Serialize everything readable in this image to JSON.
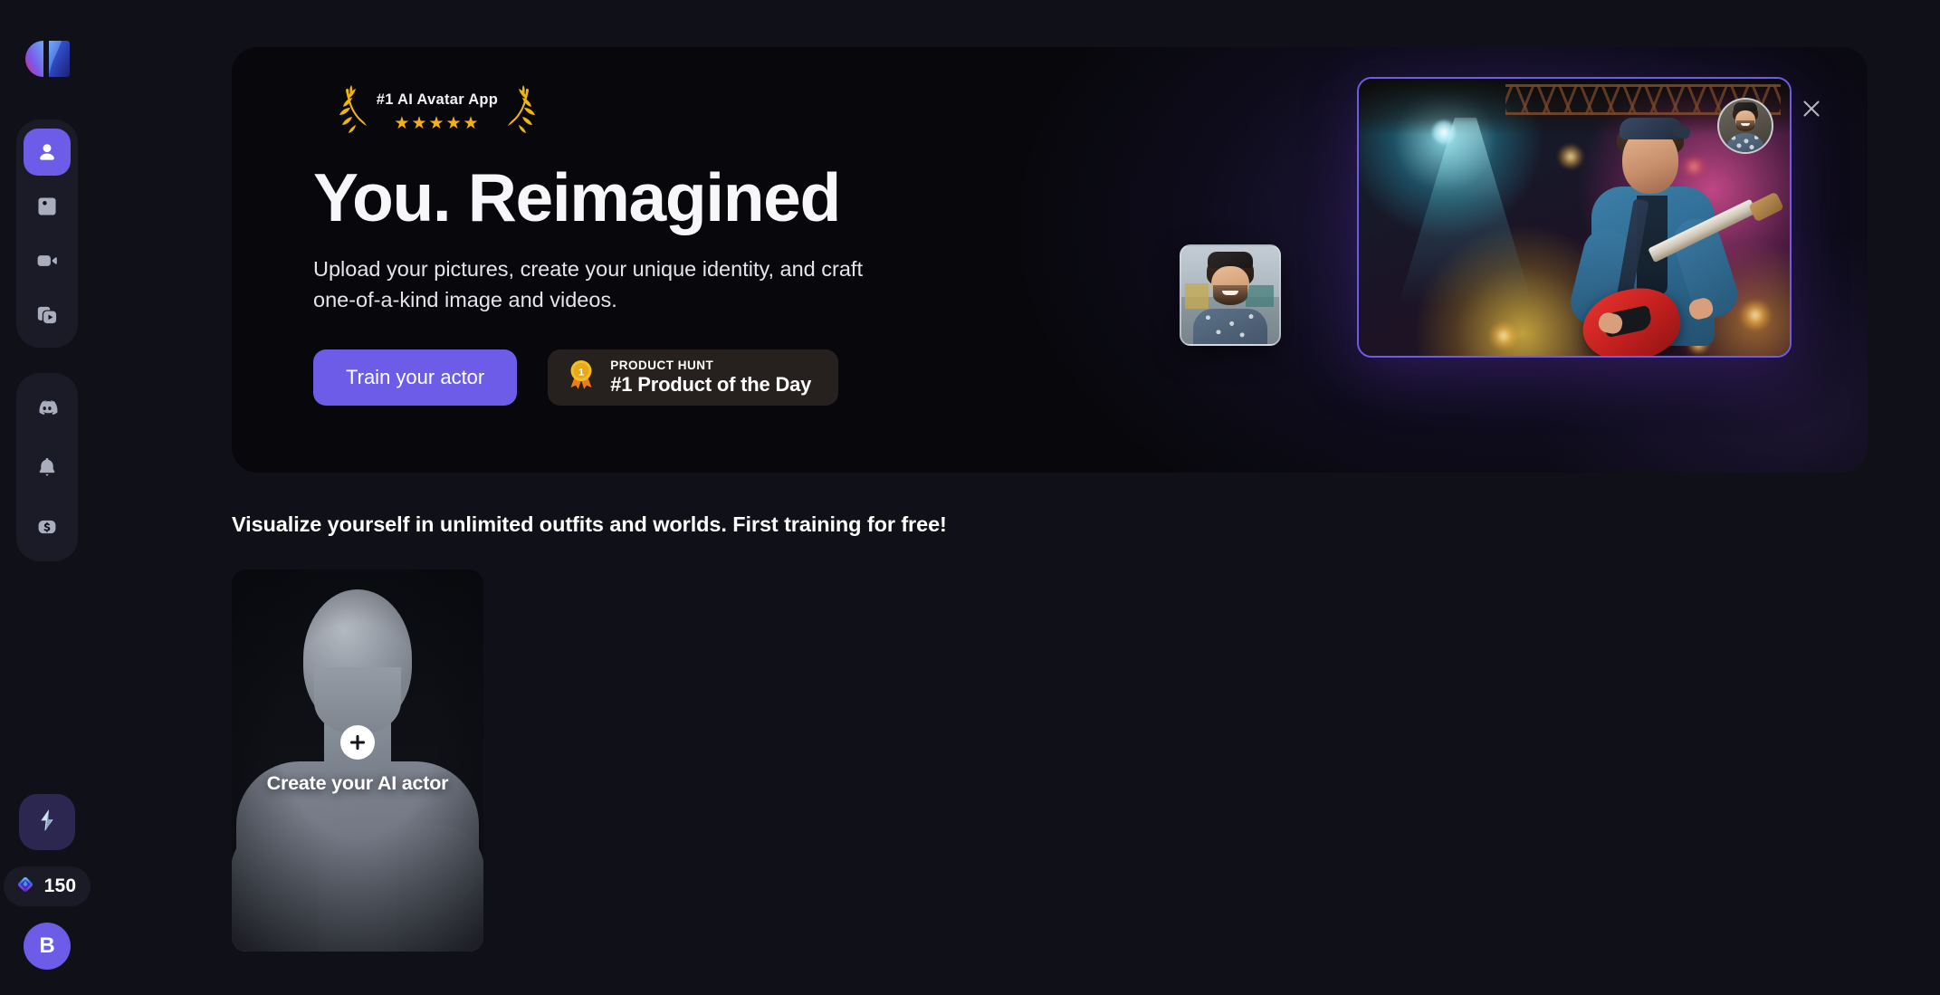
{
  "sidebar": {
    "logo": {
      "name": "app-logo"
    },
    "nav_primary": [
      {
        "id": "actors",
        "label": "Actors",
        "icon": "person-icon",
        "active": true
      },
      {
        "id": "images",
        "label": "Images",
        "icon": "image-icon",
        "active": false
      },
      {
        "id": "videos",
        "label": "Videos",
        "icon": "video-camera-icon",
        "active": false
      },
      {
        "id": "library",
        "label": "Library",
        "icon": "media-library-icon",
        "active": false
      }
    ],
    "nav_secondary": [
      {
        "id": "discord",
        "label": "Discord",
        "icon": "discord-icon"
      },
      {
        "id": "notifications",
        "label": "Notifications",
        "icon": "bell-icon"
      },
      {
        "id": "billing",
        "label": "Billing",
        "icon": "dollar-icon"
      }
    ],
    "boost": {
      "label": "Boost",
      "icon": "lightning-bolt-icon"
    },
    "credits": {
      "value": "150",
      "icon": "gem-icon"
    },
    "user_avatar": {
      "initial": "B"
    }
  },
  "banner": {
    "award": {
      "title": "#1 AI Avatar App",
      "stars": "★★★★★",
      "star_count": 5
    },
    "headline": "You. Reimagined",
    "subhead": "Upload your pictures, create your unique identity, and craft one-of-a-kind image and videos.",
    "primary_cta": "Train your actor",
    "product_hunt": {
      "kicker": "PRODUCT HUNT",
      "title": "#1 Product of the Day",
      "icon": "medal-icon"
    },
    "close": {
      "icon": "close-icon"
    },
    "hero": {
      "main_image_alt": "Guitarist performing on a stage with colorful lights",
      "avatar_alt": "Smiling man face avatar",
      "thumbnail_alt": "Smiling man in patterned blue shirt outdoors"
    }
  },
  "section": {
    "title": "Visualize yourself in unlimited outfits and worlds. First training for free!",
    "cards": [
      {
        "id": "create-ai-actor",
        "label": "Create your AI actor",
        "label_line1": "Create your AI",
        "label_line2": "actor",
        "icon": "plus-icon"
      }
    ]
  },
  "colors": {
    "accent": "#6c5ce7",
    "page_bg": "#101018",
    "banner_bg": "#08080c",
    "panel_bg": "#1a1b26",
    "gold": "#f5b014",
    "product_hunt_bg": "#26211f"
  }
}
